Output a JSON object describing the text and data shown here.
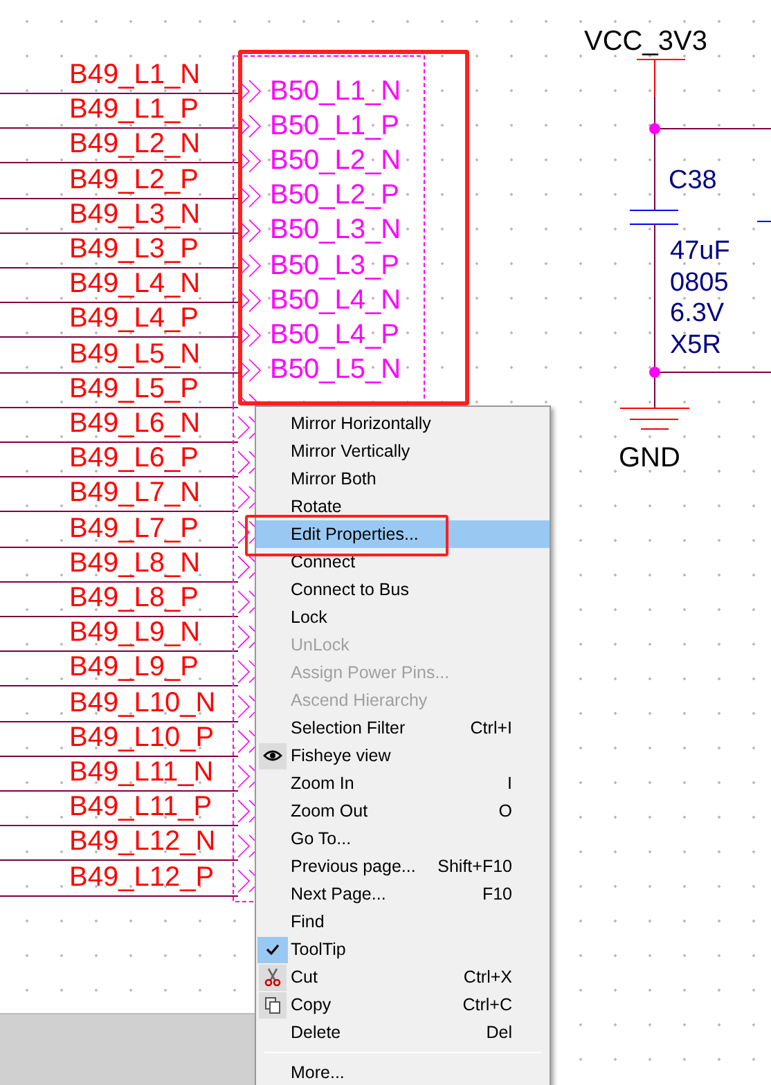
{
  "left_nets": [
    {
      "label": "B49_L1_N"
    },
    {
      "label": "B49_L1_P"
    },
    {
      "label": "B49_L2_N"
    },
    {
      "label": "B49_L2_P"
    },
    {
      "label": "B49_L3_N"
    },
    {
      "label": "B49_L3_P"
    },
    {
      "label": "B49_L4_N"
    },
    {
      "label": "B49_L4_P"
    },
    {
      "label": "B49_L5_N"
    },
    {
      "label": "B49_L5_P"
    },
    {
      "label": "B49_L6_N"
    },
    {
      "label": "B49_L6_P"
    },
    {
      "label": "B49_L7_N"
    },
    {
      "label": "B49_L7_P"
    },
    {
      "label": "B49_L8_N"
    },
    {
      "label": "B49_L8_P"
    },
    {
      "label": "B49_L9_N"
    },
    {
      "label": "B49_L9_P"
    },
    {
      "label": "B49_L10_N"
    },
    {
      "label": "B49_L10_P"
    },
    {
      "label": "B49_L11_N"
    },
    {
      "label": "B49_L11_P"
    },
    {
      "label": "B49_L12_N"
    },
    {
      "label": "B49_L12_P"
    }
  ],
  "port_labels": [
    "B50_L1_N",
    "B50_L1_P",
    "B50_L2_N",
    "B50_L2_P",
    "B50_L3_N",
    "B50_L3_P",
    "B50_L4_N",
    "B50_L4_P",
    "B50_L5_N"
  ],
  "power": {
    "net": "VCC_3V3",
    "ground": "GND"
  },
  "capacitor": {
    "ref": "C38",
    "values": [
      "47uF",
      "0805",
      "6.3V",
      "X5R"
    ]
  },
  "context_menu": [
    {
      "kind": "plain",
      "label": "Mirror Horizontally",
      "selected": false,
      "disabled": false
    },
    {
      "kind": "plain",
      "label": "Mirror Vertically",
      "selected": false,
      "disabled": false
    },
    {
      "kind": "plain",
      "label": "Mirror Both",
      "selected": false,
      "disabled": false
    },
    {
      "kind": "plain",
      "label": "Rotate",
      "selected": false,
      "disabled": false
    },
    {
      "kind": "plain",
      "label": "Edit Properties...",
      "selected": true,
      "disabled": false
    },
    {
      "kind": "plain",
      "label": "Connect",
      "selected": false,
      "disabled": false
    },
    {
      "kind": "plain",
      "label": "Connect to Bus",
      "selected": false,
      "disabled": false
    },
    {
      "kind": "plain",
      "label": "Lock",
      "selected": false,
      "disabled": false
    },
    {
      "kind": "plain",
      "label": "UnLock",
      "selected": false,
      "disabled": true
    },
    {
      "kind": "plain",
      "label": "Assign Power Pins...",
      "selected": false,
      "disabled": true
    },
    {
      "kind": "plain",
      "label": "Ascend Hierarchy",
      "selected": false,
      "disabled": true
    },
    {
      "kind": "plain",
      "label": "Selection Filter",
      "shortcut": "Ctrl+I",
      "selected": false,
      "disabled": false
    },
    {
      "kind": "eye",
      "label": "Fisheye view",
      "selected": false,
      "disabled": false
    },
    {
      "kind": "plain",
      "label": "Zoom In",
      "shortcut": "I",
      "selected": false,
      "disabled": false
    },
    {
      "kind": "plain",
      "label": "Zoom Out",
      "shortcut": "O",
      "selected": false,
      "disabled": false
    },
    {
      "kind": "plain",
      "label": "Go To...",
      "selected": false,
      "disabled": false
    },
    {
      "kind": "plain",
      "label": "Previous page...",
      "shortcut": "Shift+F10",
      "selected": false,
      "disabled": false
    },
    {
      "kind": "plain",
      "label": "Next Page...",
      "shortcut": "F10",
      "selected": false,
      "disabled": false
    },
    {
      "kind": "plain",
      "label": "Find",
      "selected": false,
      "disabled": false
    },
    {
      "kind": "plain",
      "label": "ToolTip",
      "checked": true,
      "selected": false,
      "disabled": false
    },
    {
      "kind": "scissors",
      "label": "Cut",
      "shortcut": "Ctrl+X",
      "selected": false,
      "disabled": false
    },
    {
      "kind": "copy",
      "label": "Copy",
      "shortcut": "Ctrl+C",
      "selected": false,
      "disabled": false
    },
    {
      "kind": "plain",
      "label": "Delete",
      "shortcut": "Del",
      "selected": false,
      "disabled": false
    },
    {
      "kind": "separator"
    },
    {
      "kind": "plain",
      "label": "More...",
      "selected": false,
      "disabled": false
    }
  ]
}
